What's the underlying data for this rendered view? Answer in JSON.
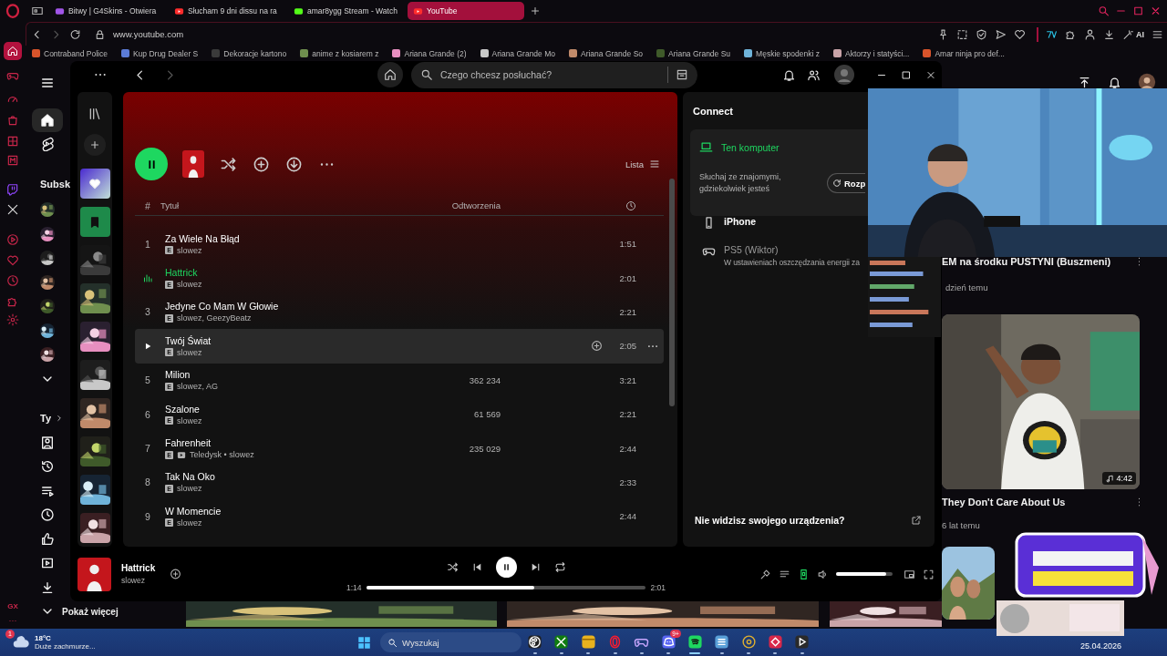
{
  "browser": {
    "tabs": [
      {
        "label": "Bitwy | G4Skins - Otwiera",
        "kind": "game",
        "selected": false
      },
      {
        "label": "Słucham 9 dni dissu na ra",
        "kind": "video",
        "selected": false
      },
      {
        "label": "amar8ygg Stream - Watch",
        "kind": "stream",
        "selected": false
      },
      {
        "label": "YouTube",
        "kind": "video",
        "selected": true
      }
    ],
    "url": "www.youtube.com",
    "ai_label": "AI",
    "bookmarks": [
      "Contraband Police",
      "Kup Drug Dealer S",
      "Dekoracje kartono",
      "anime z kosiarem z",
      "Ariana Grande (2)",
      "Ariana Grande Mo",
      "Ariana Grande So",
      "Ariana Grande Su",
      "Męskie spodenki z",
      "Aktorzy i statyści...",
      "Amar ninja pro def..."
    ],
    "sidebar_footer": [
      "GX",
      "···"
    ]
  },
  "youtube": {
    "sidebar": {
      "section_title": "Subsk",
      "you_label": "Ty",
      "show_more": "Pokaż więcej",
      "subscriptions": [
        {
          "kind": "picture"
        },
        {
          "kind": "picture"
        },
        {
          "kind": "picture"
        },
        {
          "kind": "picture"
        },
        {
          "kind": "picture"
        },
        {
          "kind": "picture"
        },
        {
          "kind": "picture"
        }
      ]
    },
    "related": [
      {
        "title": "EM na środku PUSTYNI (Buszmeni)",
        "meta": "dzień temu"
      },
      {
        "title": "They Don't Care About Us",
        "meta": "6 lat temu",
        "duration": "4:42"
      }
    ]
  },
  "spotify": {
    "search": {
      "placeholder": "Czego chcesz posłuchać?"
    },
    "library": [
      {
        "kind": "liked"
      },
      {
        "kind": "saved"
      },
      {
        "kind": "picture"
      },
      {
        "kind": "picture"
      },
      {
        "kind": "picture"
      },
      {
        "kind": "picture"
      },
      {
        "kind": "picture"
      },
      {
        "kind": "picture"
      },
      {
        "kind": "picture"
      },
      {
        "kind": "picture"
      }
    ],
    "view_label": "Lista",
    "columns": {
      "number": "#",
      "title": "Tytuł",
      "plays": "Odtworzenia"
    },
    "tracks": [
      {
        "number": "1",
        "title": "Za Wiele Na Błąd",
        "badge": "E",
        "video": false,
        "artist": "slowez",
        "duration": "1:51",
        "playing": false,
        "hovered": false
      },
      {
        "title": "Hattrick",
        "badge": "E",
        "video": false,
        "artist": "slowez",
        "duration": "2:01",
        "playing": true,
        "hovered": false
      },
      {
        "number": "3",
        "title": "Jedyne Co Mam W Głowie",
        "badge": "E",
        "video": false,
        "artist": "slowez, GeezyBeatz",
        "duration": "2:21",
        "playing": false,
        "hovered": false
      },
      {
        "title": "Twój Świat",
        "badge": "E",
        "video": false,
        "artist": "slowez",
        "duration": "2:05",
        "playing": false,
        "hovered": true
      },
      {
        "number": "5",
        "title": "Milion",
        "badge": "E",
        "video": false,
        "artist": "slowez, AG",
        "plays": "362 234",
        "duration": "3:21",
        "playing": false,
        "hovered": false
      },
      {
        "number": "6",
        "title": "Szalone",
        "badge": "E",
        "video": false,
        "artist": "slowez",
        "plays": "61 569",
        "duration": "2:21",
        "playing": false,
        "hovered": false
      },
      {
        "number": "7",
        "title": "Fahrenheit",
        "badge": "E",
        "video": true,
        "artist": "Teledysk • slowez",
        "plays": "235 029",
        "duration": "2:44",
        "playing": false,
        "hovered": false
      },
      {
        "number": "8",
        "title": "Tak Na Oko",
        "badge": "E",
        "video": false,
        "artist": "slowez",
        "duration": "2:33",
        "playing": false,
        "hovered": false
      },
      {
        "number": "9",
        "title": "W Momencie",
        "badge": "E",
        "video": false,
        "artist": "slowez",
        "duration": "2:44",
        "playing": false,
        "hovered": false
      }
    ],
    "connect": {
      "title": "Connect",
      "current": {
        "name": "Ten komputer",
        "hint": "Słuchaj ze znajomymi, gdziekolwiek jesteś",
        "button": "Rozp"
      },
      "devices": [
        {
          "kind": "phone",
          "name": "iPhone",
          "available": true
        },
        {
          "kind": "console",
          "name": "PS5 (Wiktor)",
          "available": false,
          "note": "W ustawieniach oszczędzania energii za"
        }
      ],
      "help": "Nie widzisz swojego urządzenia?"
    },
    "player": {
      "title": "Hattrick",
      "artist": "slowez",
      "playing": true,
      "elapsed": "1:14",
      "total": "2:01",
      "level": 0.6,
      "volume": {
        "level": 0.88
      }
    }
  },
  "taskbar": {
    "weather": {
      "badge": "1",
      "temp": "18°C",
      "desc": "Duże zachmurze..."
    },
    "search": {
      "placeholder": "Wyszukaj"
    },
    "apps": [
      {
        "kind": "obs",
        "active": false
      },
      {
        "kind": "xbox",
        "active": false
      },
      {
        "kind": "folder",
        "active": false
      },
      {
        "kind": "opera",
        "active": false
      },
      {
        "kind": "gamepad",
        "active": false
      },
      {
        "kind": "discord",
        "active": false,
        "badge": "9+"
      },
      {
        "kind": "spotify",
        "active": true
      },
      {
        "kind": "notepad",
        "active": false
      },
      {
        "kind": "chrome",
        "active": false
      },
      {
        "kind": "app",
        "active": false
      },
      {
        "kind": "player",
        "active": false
      }
    ],
    "date": "25.04.2026"
  }
}
